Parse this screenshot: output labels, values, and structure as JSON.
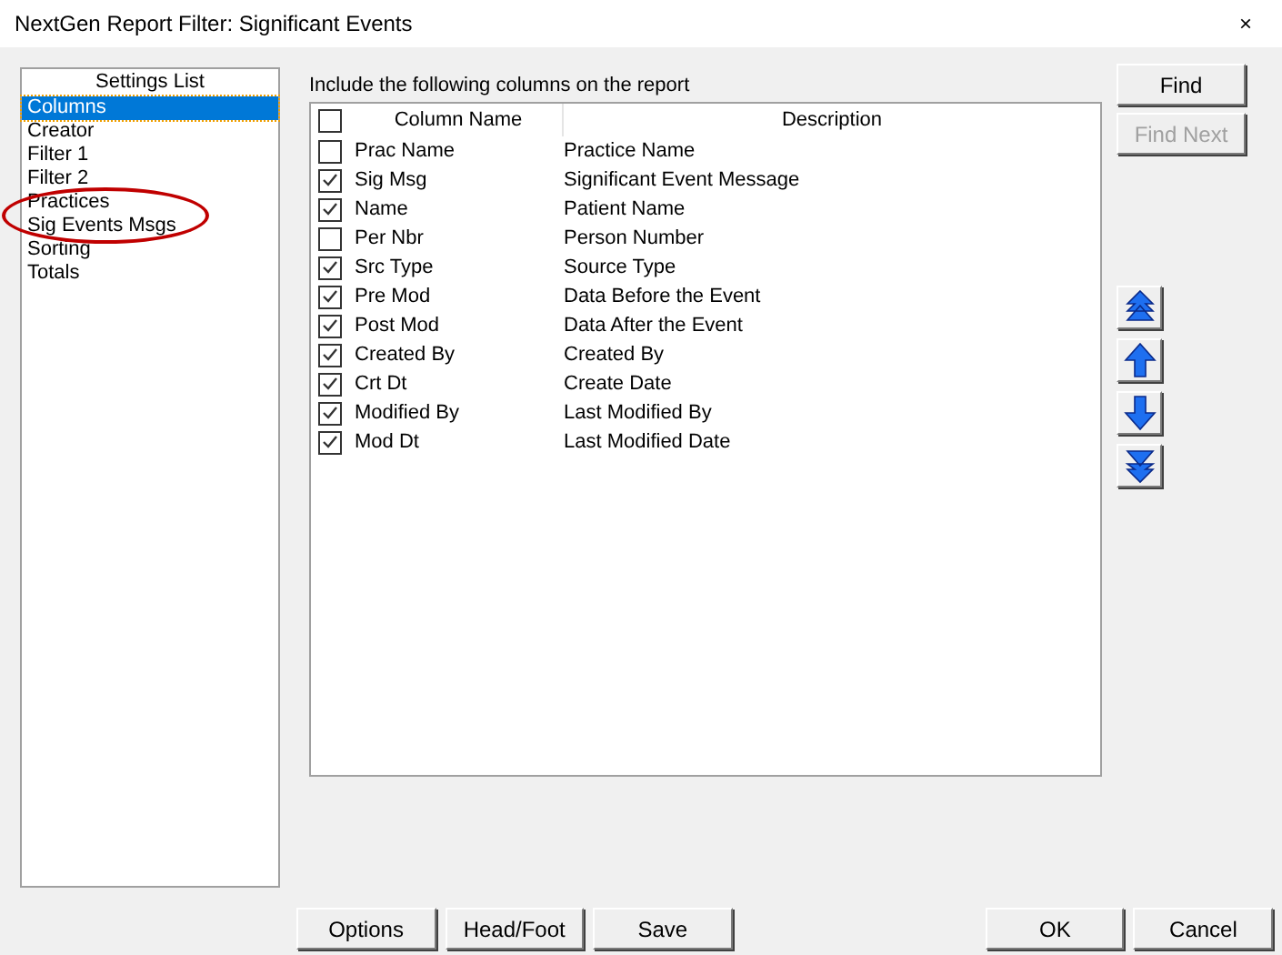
{
  "window": {
    "title": "NextGen Report Filter: Significant Events",
    "close": "×"
  },
  "settings_list": {
    "title": "Settings List",
    "items": [
      {
        "label": "Columns",
        "selected": true
      },
      {
        "label": "Creator",
        "selected": false
      },
      {
        "label": "Filter 1",
        "selected": false
      },
      {
        "label": "Filter 2",
        "selected": false
      },
      {
        "label": "Practices",
        "selected": false
      },
      {
        "label": "Sig Events Msgs",
        "selected": false
      },
      {
        "label": "Sorting",
        "selected": false
      },
      {
        "label": "Totals",
        "selected": false
      }
    ]
  },
  "columns_panel": {
    "label": "Include the following columns on the report",
    "header_checked": false,
    "headers": [
      "Column Name",
      "Description"
    ],
    "rows": [
      {
        "name": "Prac Name",
        "description": "Practice Name",
        "checked": false
      },
      {
        "name": "Sig Msg",
        "description": "Significant Event Message",
        "checked": true
      },
      {
        "name": "Name",
        "description": "Patient Name",
        "checked": true
      },
      {
        "name": "Per Nbr",
        "description": "Person Number",
        "checked": false
      },
      {
        "name": "Src Type",
        "description": "Source Type",
        "checked": true
      },
      {
        "name": "Pre Mod",
        "description": "Data Before the Event",
        "checked": true
      },
      {
        "name": "Post Mod",
        "description": "Data After the Event",
        "checked": true
      },
      {
        "name": "Created By",
        "description": "Created By",
        "checked": true
      },
      {
        "name": "Crt Dt",
        "description": "Create Date",
        "checked": true
      },
      {
        "name": "Modified By",
        "description": "Last Modified By",
        "checked": true
      },
      {
        "name": "Mod Dt",
        "description": "Last Modified Date",
        "checked": true
      }
    ]
  },
  "side_buttons": [
    {
      "label": "Find",
      "disabled": false
    },
    {
      "label": "Find Next",
      "disabled": true
    }
  ],
  "footer_buttons_left": [
    "Options",
    "Head/Foot",
    "Save"
  ],
  "footer_buttons_right": [
    "OK",
    "Cancel"
  ]
}
